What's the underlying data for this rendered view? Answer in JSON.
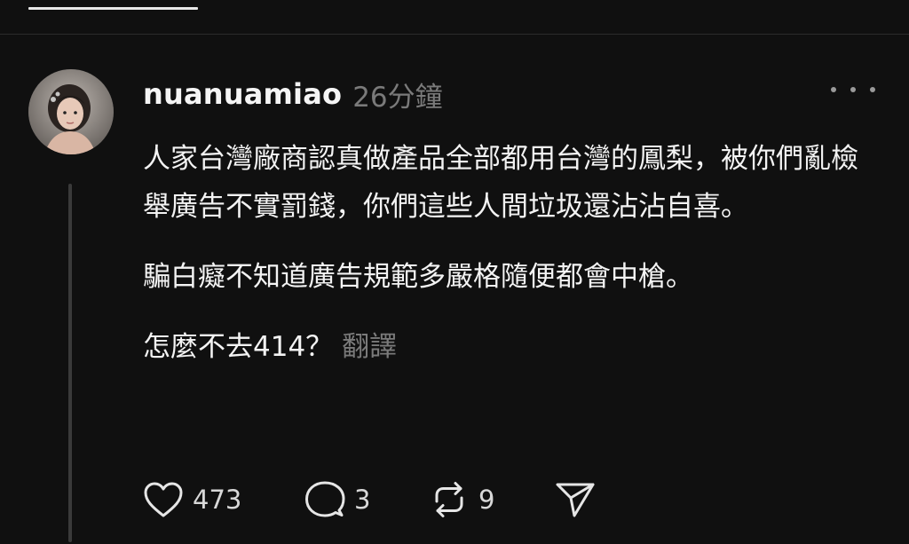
{
  "post": {
    "username": "nuanuamiao",
    "timestamp": "26分鐘",
    "paragraphs": [
      "人家台灣廠商認真做產品全部都用台灣的鳳梨，被你們亂檢舉廣告不實罰錢，你們這些人間垃圾還沾沾自喜。",
      "騙白癡不知道廣告規範多嚴格隨便都會中槍。",
      "怎麼不去414？"
    ],
    "translate_label": "翻譯",
    "actions": {
      "likes": "473",
      "replies": "3",
      "reposts": "9"
    }
  },
  "icons": {
    "more": "more-horizontal-icon",
    "like": "heart-icon",
    "reply": "comment-icon",
    "repost": "repost-icon",
    "share": "send-icon"
  }
}
